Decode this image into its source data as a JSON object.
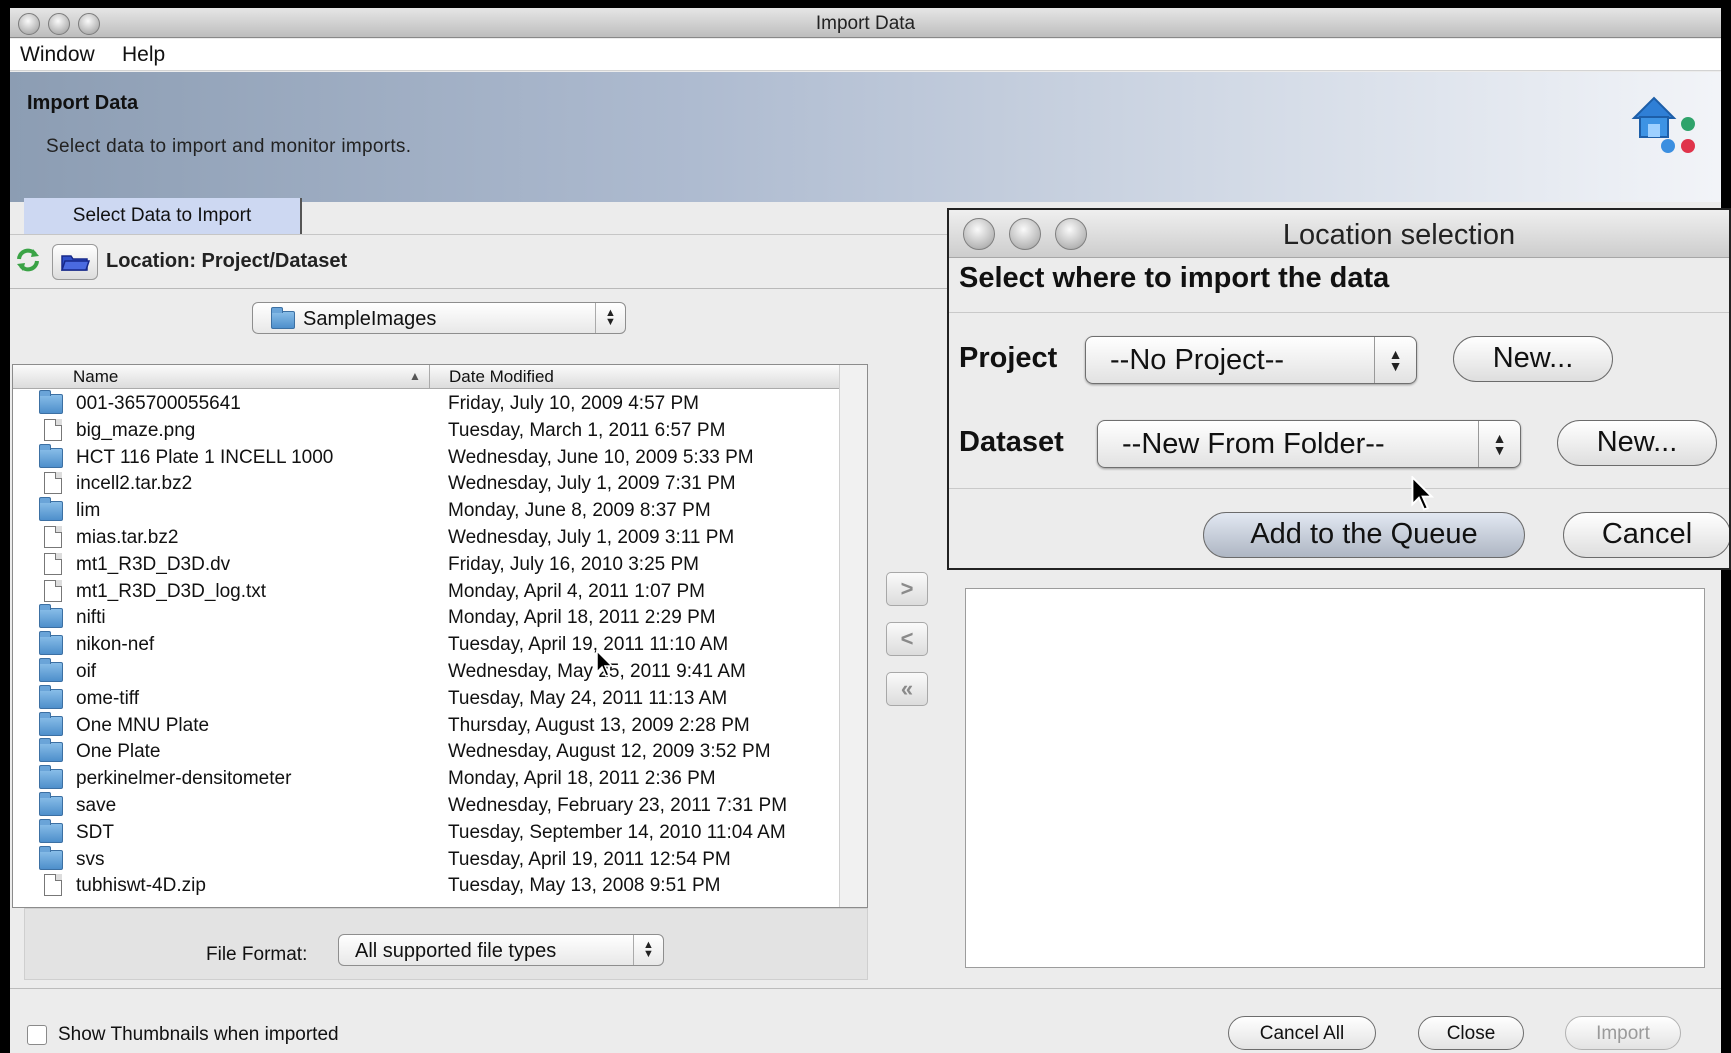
{
  "window": {
    "title": "Import Data"
  },
  "menu": {
    "items": [
      "Window",
      "Help"
    ]
  },
  "banner": {
    "heading": "Import Data",
    "description": "Select data to import and monitor imports."
  },
  "tab": {
    "label": "Select Data to Import"
  },
  "location": {
    "label": "Location: Project/Dataset"
  },
  "folder_select": {
    "value": "SampleImages"
  },
  "file_table": {
    "columns": [
      "Name",
      "Date Modified"
    ],
    "rows": [
      {
        "name": "001-365700055641",
        "date": "Friday, July 10, 2009 4:57 PM",
        "type": "folder"
      },
      {
        "name": "big_maze.png",
        "date": "Tuesday, March 1, 2011 6:57 PM",
        "type": "image"
      },
      {
        "name": "HCT 116 Plate 1 INCELL 1000",
        "date": "Wednesday, June 10, 2009 5:33 PM",
        "type": "folder"
      },
      {
        "name": "incell2.tar.bz2",
        "date": "Wednesday, July 1, 2009 7:31 PM",
        "type": "file"
      },
      {
        "name": "lim",
        "date": "Monday, June 8, 2009 8:37 PM",
        "type": "folder"
      },
      {
        "name": "mias.tar.bz2",
        "date": "Wednesday, July 1, 2009 3:11 PM",
        "type": "file"
      },
      {
        "name": "mt1_R3D_D3D.dv",
        "date": "Friday, July 16, 2010 3:25 PM",
        "type": "image"
      },
      {
        "name": "mt1_R3D_D3D_log.txt",
        "date": "Monday, April 4, 2011 1:07 PM",
        "type": "text"
      },
      {
        "name": "nifti",
        "date": "Monday, April 18, 2011 2:29 PM",
        "type": "folder"
      },
      {
        "name": "nikon-nef",
        "date": "Tuesday, April 19, 2011 11:10 AM",
        "type": "folder"
      },
      {
        "name": "oif",
        "date": "Wednesday, May 25, 2011 9:41 AM",
        "type": "folder"
      },
      {
        "name": "ome-tiff",
        "date": "Tuesday, May 24, 2011 11:13 AM",
        "type": "folder"
      },
      {
        "name": "One MNU Plate",
        "date": "Thursday, August 13, 2009 2:28 PM",
        "type": "folder"
      },
      {
        "name": "One Plate",
        "date": "Wednesday, August 12, 2009 3:52 PM",
        "type": "folder"
      },
      {
        "name": "perkinelmer-densitometer",
        "date": "Monday, April 18, 2011 2:36 PM",
        "type": "folder"
      },
      {
        "name": "save",
        "date": "Wednesday, February 23, 2011 7:31 PM",
        "type": "folder"
      },
      {
        "name": "SDT",
        "date": "Tuesday, September 14, 2010 11:04 AM",
        "type": "folder"
      },
      {
        "name": "svs",
        "date": "Tuesday, April 19, 2011 12:54 PM",
        "type": "folder"
      },
      {
        "name": "tubhiswt-4D.zip",
        "date": "Tuesday, May 13, 2008 9:51 PM",
        "type": "file"
      }
    ]
  },
  "file_format": {
    "label": "File Format:",
    "value": "All supported file types"
  },
  "thumbnails": {
    "label": "Show Thumbnails when imported",
    "checked": false
  },
  "buttons": {
    "cancel_all": "Cancel All",
    "close": "Close",
    "import": "Import"
  },
  "dialog": {
    "title": "Location selection",
    "heading": "Select where to import the data",
    "project_label": "Project",
    "project_value": "--No Project--",
    "dataset_label": "Dataset",
    "dataset_value": "--New From Folder--",
    "new_label": "New...",
    "add_label": "Add to the Queue",
    "cancel_label": "Cancel"
  }
}
